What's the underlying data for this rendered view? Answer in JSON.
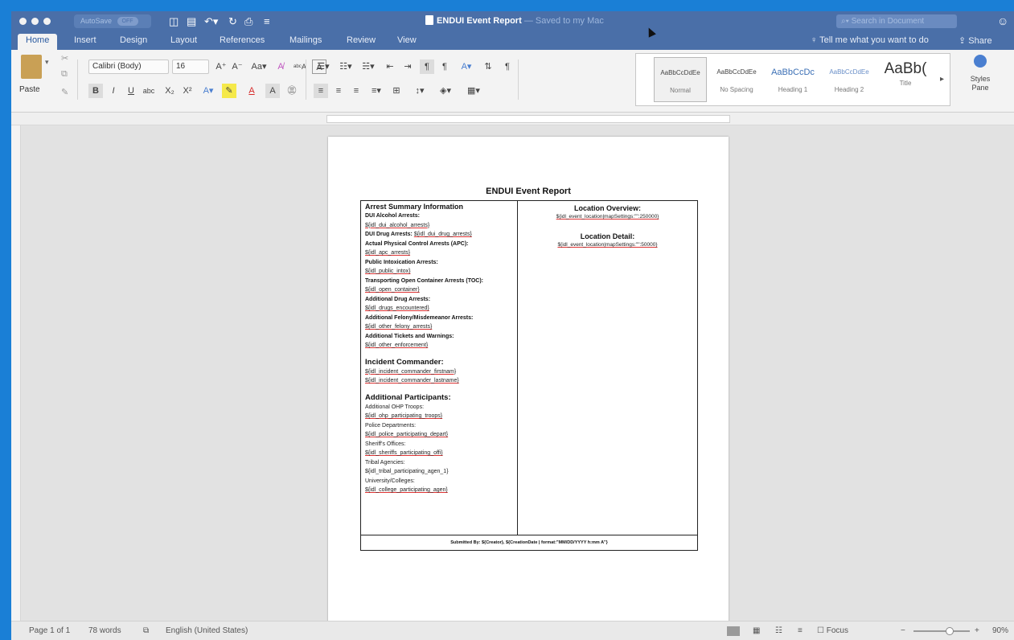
{
  "app": {
    "autosave_label": "AutoSave",
    "autosave_state": "OFF",
    "doc_name": "ENDUI Event Report",
    "saved_status": "— Saved to my Mac",
    "search_placeholder": "Search in Document"
  },
  "tabs": [
    "Home",
    "Insert",
    "Design",
    "Layout",
    "References",
    "Mailings",
    "Review",
    "View"
  ],
  "tell_me": "Tell me what you want to do",
  "share": "Share",
  "ribbon": {
    "paste_label": "Paste",
    "font_name": "Calibri (Body)",
    "font_size": "16",
    "styles": [
      {
        "sample": "AaBbCcDdEe",
        "name": "Normal"
      },
      {
        "sample": "AaBbCcDdEe",
        "name": "No Spacing"
      },
      {
        "sample": "AaBbCcDc",
        "name": "Heading 1"
      },
      {
        "sample": "AaBbCcDdEe",
        "name": "Heading 2"
      },
      {
        "sample": "AaBb(",
        "name": "Title"
      }
    ],
    "styles_pane": "Styles Pane",
    "accent": "#4a6fa8"
  },
  "document": {
    "title": "ENDUI Event Report",
    "left": {
      "heading": "Arrest Summary Information",
      "rows": [
        {
          "label": "DUI Alcohol Arrests:",
          "var": "${idl_dui_alcohol_arrests}"
        },
        {
          "label": "DUI Drug Arrests:",
          "var": "${idl_dui_drug_arrests}"
        },
        {
          "label": "Actual Physical Control Arrests (APC):",
          "var": "${idl_apc_arrests}"
        },
        {
          "label": "Public Intoxication Arrests:",
          "var": "${idl_public_intox}"
        },
        {
          "label": "Transporting Open Container Arrests (TOC):",
          "var": "${idl_open_container}"
        },
        {
          "label": "Additional Drug Arrests:",
          "var": "${idl_drugs_encountered}"
        },
        {
          "label": "Additional Felony/Misdemeanor Arrests:",
          "var": "${idl_other_felony_arrests}"
        },
        {
          "label": "Additional Tickets and Warnings:",
          "var": "${idl_other_enforcement}"
        }
      ],
      "commander_heading": "Incident Commander:",
      "commander_vars": [
        "${idl_incident_commander_firstnam}",
        "${idl_incident_commander_lastname}"
      ],
      "participants_heading": "Additional Participants:",
      "participants": [
        {
          "label": "Additional OHP Troops:",
          "var": "${idl_ohp_participating_troops}"
        },
        {
          "label": "Police Departments:",
          "var": "${idl_police_participating_depart}"
        },
        {
          "label": "Sheriff's Offices:",
          "var": "${idl_sheriffs_participating_offi}"
        },
        {
          "label": "Tribal Agencies:",
          "var": "${idl_tribal_participating_agen_1}"
        },
        {
          "label": "University/Colleges:",
          "var": "${idl_college_participating_agen}"
        }
      ]
    },
    "right": {
      "overview_heading": "Location Overview:",
      "overview_var": "${idl_event_location|mapSettings:\"\":250000}",
      "detail_heading": "Location Detail:",
      "detail_var": "${idl_event_location|mapSettings:\"\":50000}"
    },
    "footer": "Submitted By: ${Creator}, ${CreationDate | format:\"MM/DD/YYYY h:mm A\"}"
  },
  "status": {
    "page": "Page 1 of 1",
    "words": "78 words",
    "language": "English (United States)",
    "focus": "Focus",
    "zoom": "90%"
  }
}
